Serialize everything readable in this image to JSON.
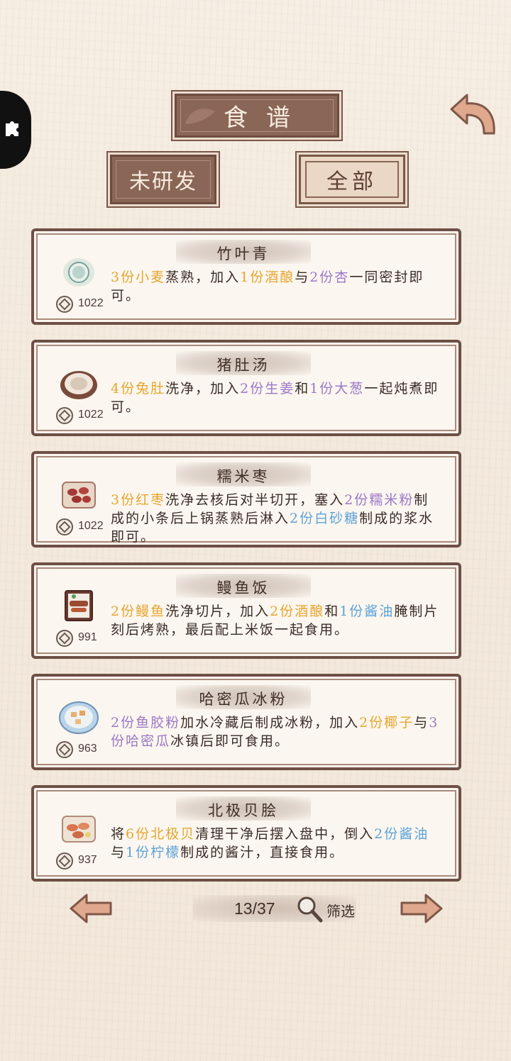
{
  "header": {
    "title": "食谱",
    "filter_label": "未研发",
    "all_label": "全部"
  },
  "colors": {
    "ingredient_yellow": "#e6a630",
    "ingredient_purple": "#9b78c8",
    "ingredient_blue": "#5da3d8",
    "plate_brown": "#8a6656"
  },
  "recipes": [
    {
      "name": "竹叶青",
      "price": "1022",
      "icon": "green-tea-cup-icon",
      "desc": [
        {
          "t": "3份小麦",
          "c": "y"
        },
        {
          "t": "蒸熟，加入",
          "c": ""
        },
        {
          "t": "1份酒酿",
          "c": "y"
        },
        {
          "t": "与",
          "c": ""
        },
        {
          "t": "2份杏",
          "c": "p"
        },
        {
          "t": "一同密封即可。",
          "c": ""
        }
      ]
    },
    {
      "name": "猪肚汤",
      "price": "1022",
      "icon": "soup-pot-icon",
      "desc": [
        {
          "t": "4份兔肚",
          "c": "y"
        },
        {
          "t": "洗净，加入",
          "c": ""
        },
        {
          "t": "2份生姜",
          "c": "p"
        },
        {
          "t": "和",
          "c": ""
        },
        {
          "t": "1份大葱",
          "c": "p"
        },
        {
          "t": "一起炖煮即可。",
          "c": ""
        }
      ]
    },
    {
      "name": "糯米枣",
      "price": "1022",
      "icon": "red-date-plate-icon",
      "desc": [
        {
          "t": "3份红枣",
          "c": "y"
        },
        {
          "t": "洗净去核后对半切开，塞入",
          "c": ""
        },
        {
          "t": "2份糯米粉",
          "c": "p"
        },
        {
          "t": "制成的小条后上锅蒸熟后淋入",
          "c": ""
        },
        {
          "t": "2份白砂糖",
          "c": "b"
        },
        {
          "t": "制成的浆水即可。",
          "c": ""
        }
      ]
    },
    {
      "name": "鳗鱼饭",
      "price": "991",
      "icon": "eel-rice-box-icon",
      "desc": [
        {
          "t": "2份鳗鱼",
          "c": "y"
        },
        {
          "t": "洗净切片，加入",
          "c": ""
        },
        {
          "t": "2份酒酿",
          "c": "y"
        },
        {
          "t": "和",
          "c": ""
        },
        {
          "t": "1份酱油",
          "c": "b"
        },
        {
          "t": "腌制片刻后烤熟，最后配上米饭一起食用。",
          "c": ""
        }
      ]
    },
    {
      "name": "哈密瓜冰粉",
      "price": "963",
      "icon": "melon-jelly-bowl-icon",
      "desc": [
        {
          "t": "2份鱼胶粉",
          "c": "p"
        },
        {
          "t": "加水冷藏后制成冰粉，加入",
          "c": ""
        },
        {
          "t": "2份椰子",
          "c": "y"
        },
        {
          "t": "与",
          "c": ""
        },
        {
          "t": "3份哈密瓜",
          "c": "p"
        },
        {
          "t": "冰镇后即可食用。",
          "c": ""
        }
      ]
    },
    {
      "name": "北极贝脍",
      "price": "937",
      "icon": "arctic-clam-plate-icon",
      "desc": [
        {
          "t": "将",
          "c": ""
        },
        {
          "t": "6份北极贝",
          "c": "y"
        },
        {
          "t": "清理干净后摆入盘中，倒入",
          "c": ""
        },
        {
          "t": "2份酱油",
          "c": "b"
        },
        {
          "t": "与",
          "c": ""
        },
        {
          "t": "1份柠檬",
          "c": "b"
        },
        {
          "t": "制成的酱汁，直接食用。",
          "c": ""
        }
      ]
    }
  ],
  "pager": {
    "page": "13/37",
    "filter": "筛选"
  }
}
